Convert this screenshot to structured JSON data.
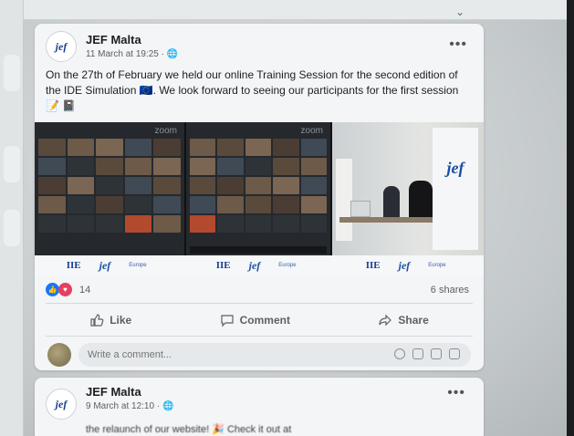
{
  "post": {
    "author": "JEF Malta",
    "avatar_text": "jef",
    "timestamp": "11 March at 19:25",
    "audience_icon": "globe-icon",
    "more": "•••",
    "text": "On the 27th of February we held our online Training Session for the second edition of the IDE Simulation 🇪🇺. We look forward to seeing our participants for the first session 📝 📓",
    "zoom_label_1": "zoom",
    "zoom_label_2": "zoom",
    "banner_text": "jef",
    "logos": {
      "ide": "IIE",
      "jef": "jef",
      "small": "Europe"
    },
    "reactions_count": "14",
    "shares": "6 shares",
    "actions": {
      "like": "Like",
      "comment": "Comment",
      "share": "Share"
    },
    "comment_placeholder": "Write a comment..."
  },
  "post2": {
    "author": "JEF Malta",
    "avatar_text": "jef",
    "timestamp": "9 March at 12:10",
    "more": "•••",
    "preview": "the relaunch of our website! 🎉 Check it out at"
  },
  "colors": {
    "like_blue": "#1877f2",
    "love_red": "#e4405f",
    "brand_blue": "#1b4fa0"
  }
}
